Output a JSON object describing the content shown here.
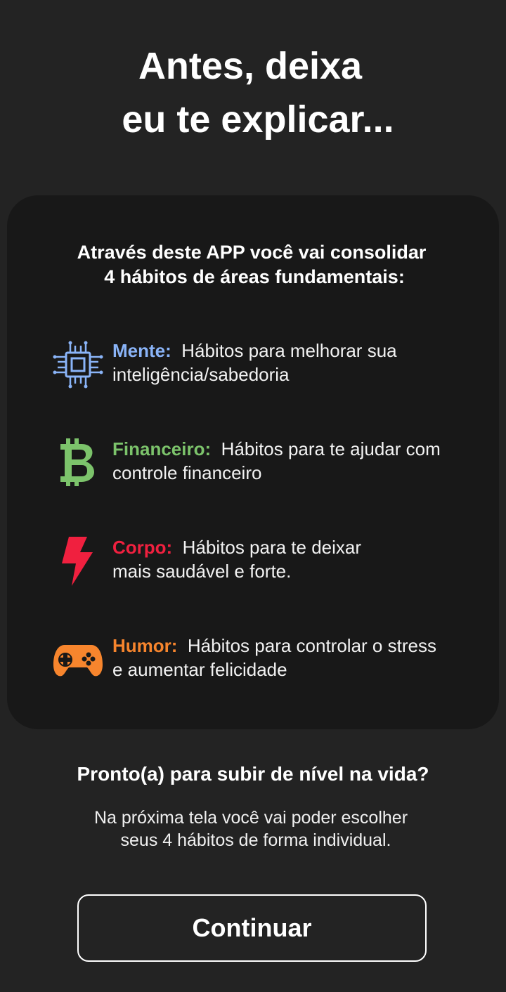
{
  "header": {
    "title_line1": "Antes, deixa",
    "title_line2": "eu te explicar..."
  },
  "card": {
    "heading_line1": "Através deste APP você vai consolidar",
    "heading_line2": "4 hábitos de áreas fundamentais:",
    "habits": [
      {
        "name": "Mente:",
        "desc_line1": "Hábitos para melhorar sua",
        "desc_line2": "inteligência/sabedoria",
        "icon": "cpu-chip-icon",
        "color": "#8ab4f8"
      },
      {
        "name": "Financeiro:",
        "desc_line1": "Hábitos para te ajudar com",
        "desc_line2": "controle financeiro",
        "icon": "bitcoin-icon",
        "color": "#7cc36b"
      },
      {
        "name": "Corpo:",
        "desc_line1": "Hábitos para te deixar",
        "desc_line2": "mais saudável e forte.",
        "icon": "lightning-bolt-icon",
        "color": "#f0203f"
      },
      {
        "name": "Humor:",
        "desc_line1": "Hábitos para controlar o stress",
        "desc_line2": "e aumentar felicidade",
        "icon": "gamepad-icon",
        "color": "#f7852d"
      }
    ]
  },
  "footer": {
    "ready_text": "Pronto(a) para subir de nível na vida?",
    "sub_line1": "Na próxima tela você vai poder escolher",
    "sub_line2": "seus 4 hábitos de forma individual.",
    "continue_label": "Continuar"
  }
}
